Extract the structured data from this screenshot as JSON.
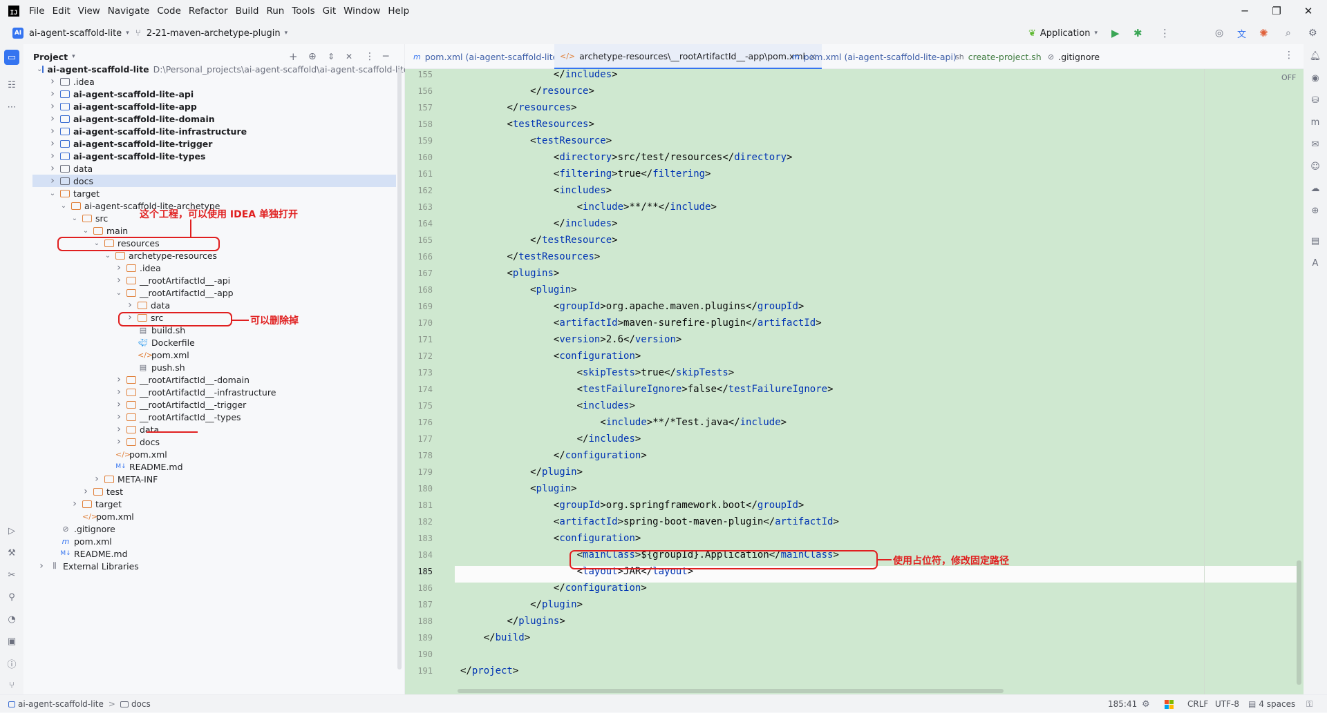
{
  "menu": [
    "File",
    "Edit",
    "View",
    "Navigate",
    "Code",
    "Refactor",
    "Build",
    "Run",
    "Tools",
    "Git",
    "Window",
    "Help"
  ],
  "toolbar": {
    "project_badge": "AI",
    "project_name": "ai-agent-scaffold-lite",
    "branch": "2-21-maven-archetype-plugin",
    "run_config": "Application"
  },
  "project_panel": {
    "title": "Project",
    "tree": [
      {
        "depth": 0,
        "chev": "v",
        "icon": "module",
        "label": "ai-agent-scaffold-lite",
        "bold": true,
        "path": "D:\\Personal_projects\\ai-agent-scaffold\\ai-agent-scaffold-lite"
      },
      {
        "depth": 1,
        "chev": ">",
        "icon": "folder",
        "label": ".idea"
      },
      {
        "depth": 1,
        "chev": ">",
        "icon": "module",
        "label": "ai-agent-scaffold-lite-api",
        "bold": true
      },
      {
        "depth": 1,
        "chev": ">",
        "icon": "module",
        "label": "ai-agent-scaffold-lite-app",
        "bold": true
      },
      {
        "depth": 1,
        "chev": ">",
        "icon": "module",
        "label": "ai-agent-scaffold-lite-domain",
        "bold": true
      },
      {
        "depth": 1,
        "chev": ">",
        "icon": "module",
        "label": "ai-agent-scaffold-lite-infrastructure",
        "bold": true
      },
      {
        "depth": 1,
        "chev": ">",
        "icon": "module",
        "label": "ai-agent-scaffold-lite-trigger",
        "bold": true
      },
      {
        "depth": 1,
        "chev": ">",
        "icon": "module",
        "label": "ai-agent-scaffold-lite-types",
        "bold": true
      },
      {
        "depth": 1,
        "chev": ">",
        "icon": "folder",
        "label": "data"
      },
      {
        "depth": 1,
        "chev": ">",
        "icon": "folder",
        "label": "docs",
        "selected": true
      },
      {
        "depth": 1,
        "chev": "v",
        "icon": "folder-orange",
        "label": "target"
      },
      {
        "depth": 2,
        "chev": "v",
        "icon": "folder-orange",
        "label": "ai-agent-scaffold-lite-archetype"
      },
      {
        "depth": 3,
        "chev": "v",
        "icon": "folder-orange",
        "label": "src"
      },
      {
        "depth": 4,
        "chev": "v",
        "icon": "folder-orange",
        "label": "main"
      },
      {
        "depth": 5,
        "chev": "v",
        "icon": "folder-orange",
        "label": "resources"
      },
      {
        "depth": 6,
        "chev": "v",
        "icon": "folder-orange",
        "label": "archetype-resources"
      },
      {
        "depth": 7,
        "chev": ">",
        "icon": "folder-orange",
        "label": ".idea"
      },
      {
        "depth": 7,
        "chev": ">",
        "icon": "folder-orange",
        "label": "__rootArtifactId__-api"
      },
      {
        "depth": 7,
        "chev": "v",
        "icon": "folder-orange",
        "label": "__rootArtifactId__-app"
      },
      {
        "depth": 8,
        "chev": ">",
        "icon": "folder-orange",
        "label": "data"
      },
      {
        "depth": 8,
        "chev": ">",
        "icon": "folder-orange",
        "label": "src"
      },
      {
        "depth": 8,
        "chev": "",
        "icon": "sh",
        "label": "build.sh"
      },
      {
        "depth": 8,
        "chev": "",
        "icon": "docker",
        "label": "Dockerfile"
      },
      {
        "depth": 8,
        "chev": "",
        "icon": "xml",
        "label": "pom.xml"
      },
      {
        "depth": 8,
        "chev": "",
        "icon": "sh",
        "label": "push.sh"
      },
      {
        "depth": 7,
        "chev": ">",
        "icon": "folder-orange",
        "label": "__rootArtifactId__-domain"
      },
      {
        "depth": 7,
        "chev": ">",
        "icon": "folder-orange",
        "label": "__rootArtifactId__-infrastructure"
      },
      {
        "depth": 7,
        "chev": ">",
        "icon": "folder-orange",
        "label": "__rootArtifactId__-trigger"
      },
      {
        "depth": 7,
        "chev": ">",
        "icon": "folder-orange",
        "label": "__rootArtifactId__-types"
      },
      {
        "depth": 7,
        "chev": ">",
        "icon": "folder-orange",
        "label": "data"
      },
      {
        "depth": 7,
        "chev": ">",
        "icon": "folder-orange",
        "label": "docs"
      },
      {
        "depth": 6,
        "chev": "",
        "icon": "xml",
        "label": "pom.xml"
      },
      {
        "depth": 6,
        "chev": "",
        "icon": "md",
        "label": "README.md"
      },
      {
        "depth": 5,
        "chev": ">",
        "icon": "folder-orange",
        "label": "META-INF"
      },
      {
        "depth": 4,
        "chev": ">",
        "icon": "folder-orange",
        "label": "test"
      },
      {
        "depth": 3,
        "chev": ">",
        "icon": "folder-orange",
        "label": "target"
      },
      {
        "depth": 3,
        "chev": "",
        "icon": "xml",
        "label": "pom.xml"
      },
      {
        "depth": 1,
        "chev": "",
        "icon": "gitignore",
        "label": ".gitignore"
      },
      {
        "depth": 1,
        "chev": "",
        "icon": "maven",
        "label": "pom.xml"
      },
      {
        "depth": 1,
        "chev": "",
        "icon": "md",
        "label": "README.md"
      },
      {
        "depth": 0,
        "chev": ">",
        "icon": "lib",
        "label": "External Libraries"
      }
    ]
  },
  "tabs": [
    {
      "icon": "m",
      "label": "pom.xml (ai-agent-scaffold-lite)"
    },
    {
      "icon": "</>",
      "label": "archetype-resources\\__rootArtifactId__-app\\pom.xml",
      "active": true,
      "close": "×"
    },
    {
      "icon": "m",
      "label": "pom.xml (ai-agent-scaffold-lite-api)"
    },
    {
      "icon": "sh",
      "label": "create-project.sh"
    },
    {
      "icon": "⊘",
      "label": ".gitignore"
    }
  ],
  "editor": {
    "readonly_badge": "OFF",
    "current_line": 185,
    "lines": [
      {
        "n": 155,
        "indent": 16,
        "text": "</includes>"
      },
      {
        "n": 156,
        "indent": 12,
        "text": "</resource>"
      },
      {
        "n": 157,
        "indent": 8,
        "text": "</resources>"
      },
      {
        "n": 158,
        "indent": 8,
        "text": "<testResources>"
      },
      {
        "n": 159,
        "indent": 12,
        "text": "<testResource>"
      },
      {
        "n": 160,
        "indent": 16,
        "text": "<directory>src/test/resources</directory>"
      },
      {
        "n": 161,
        "indent": 16,
        "text": "<filtering>true</filtering>"
      },
      {
        "n": 162,
        "indent": 16,
        "text": "<includes>"
      },
      {
        "n": 163,
        "indent": 20,
        "text": "<include>**/**</include>"
      },
      {
        "n": 164,
        "indent": 16,
        "text": "</includes>"
      },
      {
        "n": 165,
        "indent": 12,
        "text": "</testResource>"
      },
      {
        "n": 166,
        "indent": 8,
        "text": "</testResources>"
      },
      {
        "n": 167,
        "indent": 8,
        "text": "<plugins>"
      },
      {
        "n": 168,
        "indent": 12,
        "text": "<plugin>"
      },
      {
        "n": 169,
        "indent": 16,
        "text": "<groupId>org.apache.maven.plugins</groupId>"
      },
      {
        "n": 170,
        "indent": 16,
        "text": "<artifactId>maven-surefire-plugin</artifactId>"
      },
      {
        "n": 171,
        "indent": 16,
        "text": "<version>2.6</version>"
      },
      {
        "n": 172,
        "indent": 16,
        "text": "<configuration>"
      },
      {
        "n": 173,
        "indent": 20,
        "text": "<skipTests>true</skipTests>"
      },
      {
        "n": 174,
        "indent": 20,
        "text": "<testFailureIgnore>false</testFailureIgnore>"
      },
      {
        "n": 175,
        "indent": 20,
        "text": "<includes>"
      },
      {
        "n": 176,
        "indent": 24,
        "text": "<include>**/*Test.java</include>"
      },
      {
        "n": 177,
        "indent": 20,
        "text": "</includes>"
      },
      {
        "n": 178,
        "indent": 16,
        "text": "</configuration>"
      },
      {
        "n": 179,
        "indent": 12,
        "text": "</plugin>"
      },
      {
        "n": 180,
        "indent": 12,
        "text": "<plugin>"
      },
      {
        "n": 181,
        "indent": 16,
        "text": "<groupId>org.springframework.boot</groupId>"
      },
      {
        "n": 182,
        "indent": 16,
        "text": "<artifactId>spring-boot-maven-plugin</artifactId>"
      },
      {
        "n": 183,
        "indent": 16,
        "text": "<configuration>"
      },
      {
        "n": 184,
        "indent": 20,
        "text": "<mainClass>${groupId}.Application</mainClass>"
      },
      {
        "n": 185,
        "indent": 20,
        "text": "<layout>JAR</layout>"
      },
      {
        "n": 186,
        "indent": 16,
        "text": "</configuration>"
      },
      {
        "n": 187,
        "indent": 12,
        "text": "</plugin>"
      },
      {
        "n": 188,
        "indent": 8,
        "text": "</plugins>"
      },
      {
        "n": 189,
        "indent": 4,
        "text": "</build>"
      },
      {
        "n": 190,
        "indent": 0,
        "text": ""
      },
      {
        "n": 191,
        "indent": 0,
        "text": "</project>"
      }
    ]
  },
  "annotations": {
    "open_separately": "这个工程，可以使用 IDEA 单独打开",
    "can_delete": "可以删除掉",
    "placeholder": "使用占位符，修改固定路径"
  },
  "statusbar": {
    "breadcrumb_root": "ai-agent-scaffold-lite",
    "breadcrumb_sep": ">",
    "breadcrumb_leaf": "docs",
    "position": "185:41",
    "line_ending": "CRLF",
    "encoding": "UTF-8",
    "indent": "4 spaces"
  },
  "colors": {
    "accent": "#3574f0",
    "annotation": "#e01f1f",
    "editor_bg": "#cfe8d0",
    "tag": "#0033b3"
  }
}
